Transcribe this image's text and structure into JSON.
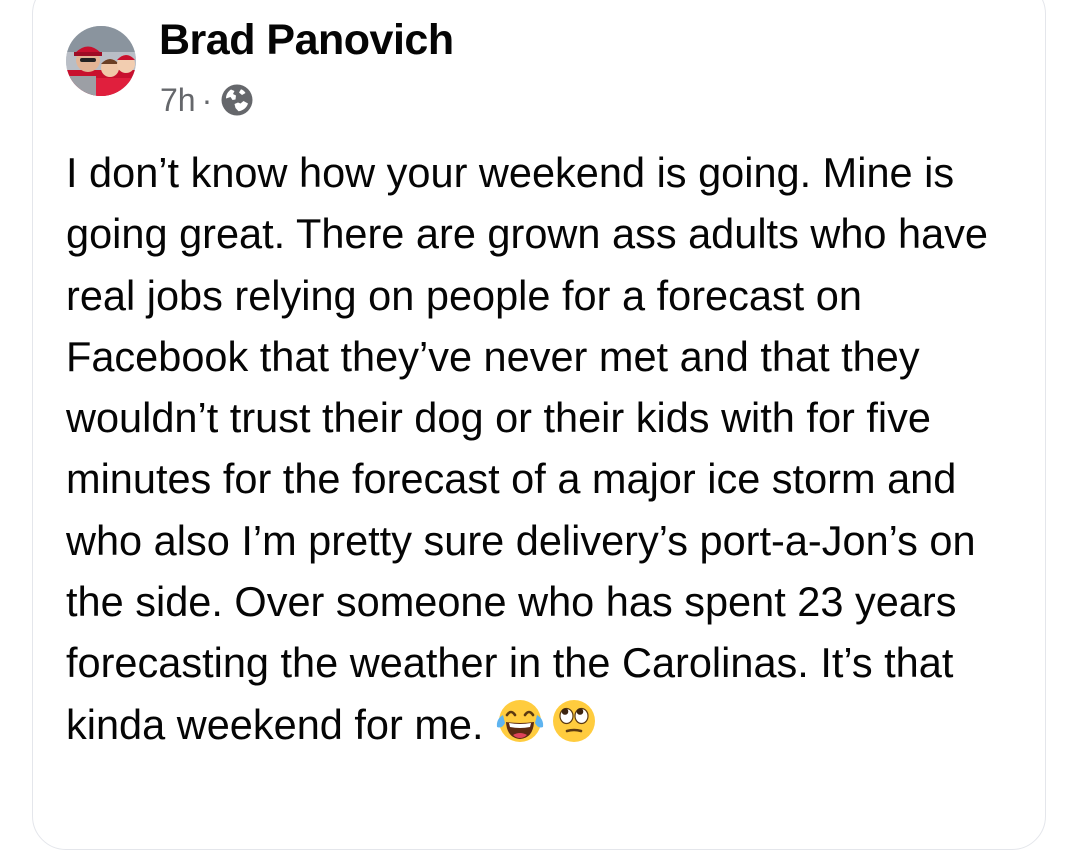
{
  "post": {
    "author": "Brad Panovich",
    "timestamp": "7h",
    "separator": "·",
    "visibility_icon": "globe-icon",
    "text": "I don’t know how your weekend is going. Mine is going great. There are grown ass adults who have real jobs relying on people for a forecast on Facebook that they’ve never met and that they wouldn’t trust their dog or their kids with for five minutes for the forecast of a major ice storm and who also I’m pretty sure delivery’s port-a-Jon’s on the side. Over someone who has spent 23 years forecasting the weather in the Carolinas. It’s that kinda weekend for me.",
    "emojis": [
      "face-with-tears-of-joy-icon",
      "face-with-rolling-eyes-icon"
    ]
  },
  "colors": {
    "text_primary": "#050505",
    "text_secondary": "#65676b",
    "card_border": "#e4e6eb",
    "background": "#ffffff"
  }
}
